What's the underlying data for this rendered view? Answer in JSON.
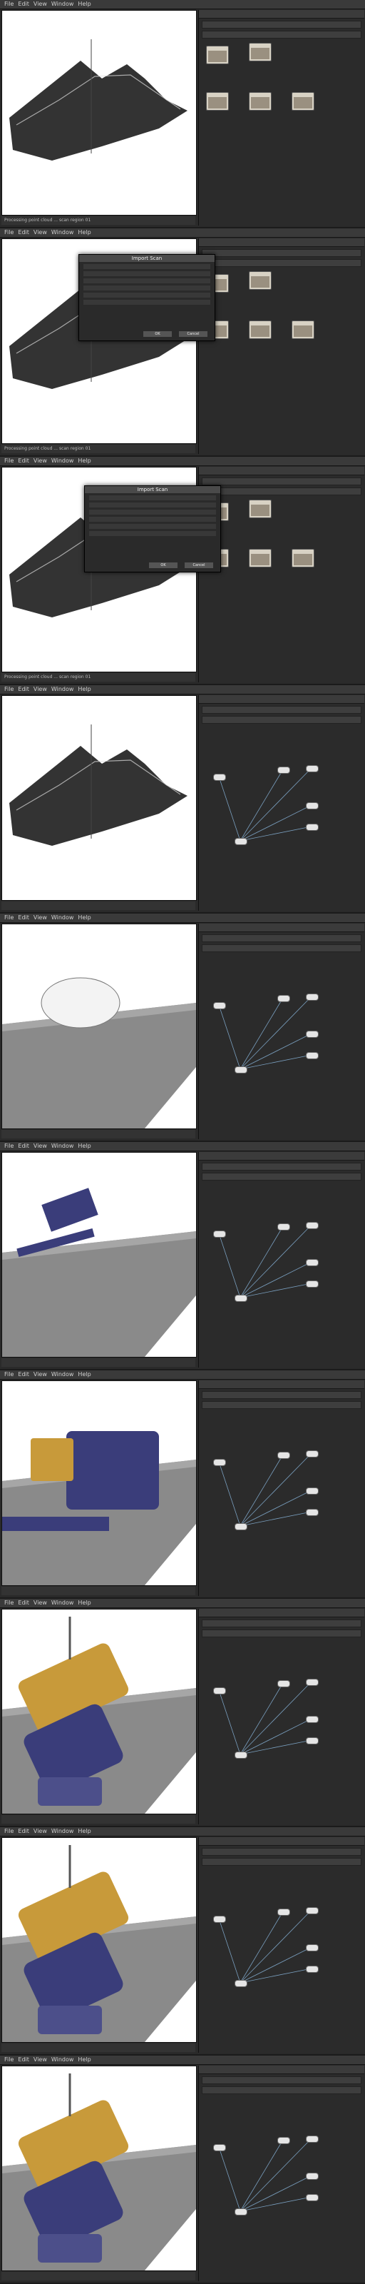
{
  "app": {
    "menus": [
      "File",
      "Edit",
      "View",
      "Window",
      "Help"
    ]
  },
  "frames": [
    {
      "status": "Processing point cloud ... scan region 01",
      "dialog": null
    },
    {
      "status": "Processing point cloud ... scan region 01",
      "dialog": {
        "title": "Import Scan"
      }
    },
    {
      "status": "Processing point cloud ... scan region 01",
      "dialog": {
        "title": "Import Scan"
      }
    },
    {
      "status": "",
      "dialog": null
    },
    {
      "status": "",
      "dialog": null
    },
    {
      "status": "",
      "dialog": null
    },
    {
      "status": "",
      "dialog": null
    },
    {
      "status": "",
      "dialog": null
    },
    {
      "status": "",
      "dialog": null
    },
    {
      "status": "",
      "dialog": null
    }
  ],
  "dialog_buttons": {
    "ok": "OK",
    "cancel": "Cancel"
  },
  "colors": {
    "viewport_bg": "#ffffff",
    "panel_bg": "#2b2b2b",
    "node_color": "#d8d2c4",
    "robot_blue": "#3a3d7a",
    "robot_gold": "#c89a3a"
  }
}
